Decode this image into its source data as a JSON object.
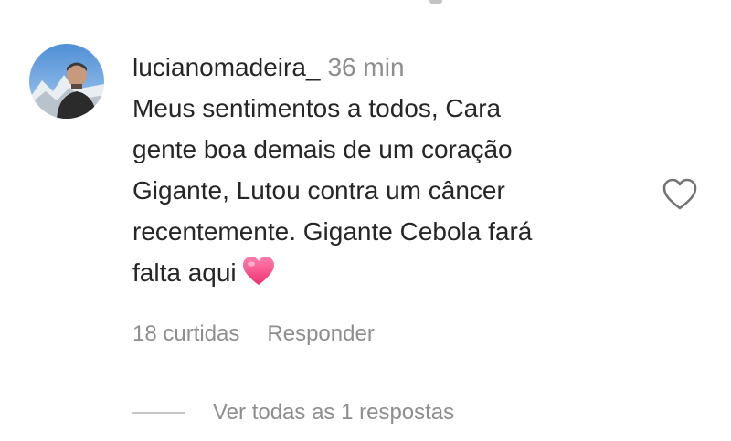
{
  "comment": {
    "username": "lucianomadeira_",
    "time": "36 min",
    "text_lines": [
      "Meus sentimentos a todos, Cara",
      "gente boa demais de um coração",
      "Gigante, Lutou contra um câncer",
      "recentemente. Gigante Cebola fará",
      "falta aqui"
    ],
    "emoji": "pink-heart-emoji",
    "likes_label": "18 curtidas",
    "reply_label": "Responder",
    "view_replies_label": "Ver todas as 1 respostas"
  },
  "icons": {
    "like": "heart-outline-icon",
    "avatar": "profile-photo"
  },
  "colors": {
    "text": "#262626",
    "muted": "#8e8e8e",
    "divider": "#c7c7c7",
    "emoji_heart": "#ff4f8b"
  }
}
